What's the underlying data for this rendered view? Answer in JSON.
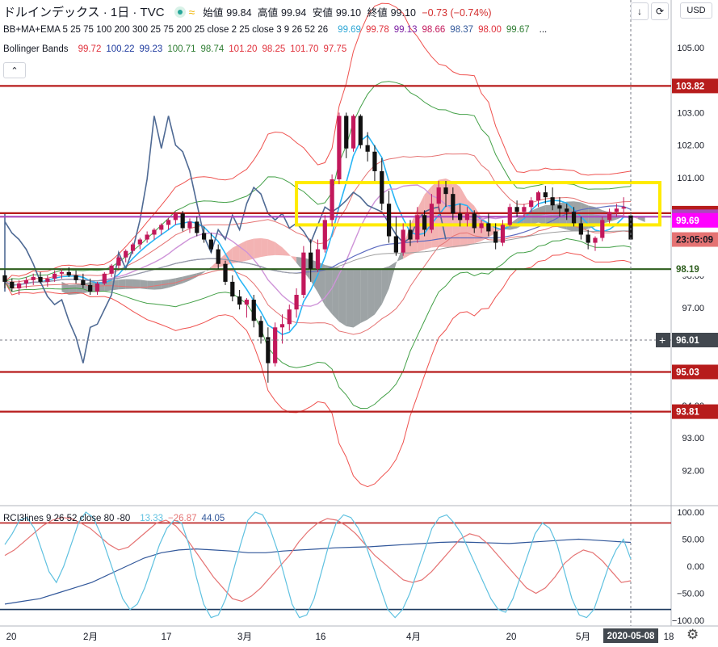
{
  "header": {
    "title": "ドルインデックス · 1日 · TVC",
    "ohlc": [
      {
        "label": "始値",
        "value": "99.84"
      },
      {
        "label": "高値",
        "value": "99.94"
      },
      {
        "label": "安値",
        "value": "99.10"
      },
      {
        "label": "終値",
        "value": "99.10"
      }
    ],
    "change": "−0.73 (−0.74%)",
    "currency": "USD",
    "wave_icon": "≈",
    "down_icon": "↓",
    "refresh_icon": "⟳",
    "collapse_icon": "⌃",
    "gear_icon": "⚙"
  },
  "legend_main": {
    "name": "BB+MA+EMA 5 25 75 100 200 300 25 75 200 25 close 2 25 close 3 9 26 52 26",
    "values": [
      {
        "v": "99.69",
        "color": "#2ea7d6"
      },
      {
        "v": "99.78",
        "color": "#e0303b"
      },
      {
        "v": "99.13",
        "color": "#7b1fa2"
      },
      {
        "v": "98.66",
        "color": "#c2185b"
      },
      {
        "v": "98.37",
        "color": "#31579a"
      },
      {
        "v": "98.00",
        "color": "#e0303b"
      },
      {
        "v": "99.67",
        "color": "#2e7d32"
      }
    ],
    "ellipsis": "..."
  },
  "legend_bb": {
    "name": "Bollinger Bands",
    "values": [
      {
        "v": "99.72",
        "color": "#e0303b"
      },
      {
        "v": "100.22",
        "color": "#1e3a9e"
      },
      {
        "v": "99.23",
        "color": "#1e3a9e"
      },
      {
        "v": "100.71",
        "color": "#2e7d32"
      },
      {
        "v": "98.74",
        "color": "#2e7d32"
      },
      {
        "v": "101.20",
        "color": "#e0303b"
      },
      {
        "v": "98.25",
        "color": "#e0303b"
      },
      {
        "v": "101.70",
        "color": "#e0303b"
      },
      {
        "v": "97.75",
        "color": "#e0303b"
      }
    ]
  },
  "legend_rci": {
    "name": "RCI3lines 9 26 52 close 80 -80",
    "values": [
      {
        "v": "13.33",
        "color": "#5fc1e0"
      },
      {
        "v": "−26.87",
        "color": "#e57373"
      },
      {
        "v": "44.05",
        "color": "#31579a"
      }
    ]
  },
  "chart_data": {
    "type": "candlestick",
    "symbol": "ドルインデックス",
    "y_axis": {
      "ticks": [
        92.0,
        93.0,
        94.0,
        95.0,
        97.0,
        98.0,
        99.0,
        101.0,
        102.0,
        103.0,
        105.0
      ],
      "ylim": [
        91.1,
        106.0
      ]
    },
    "x_axis": {
      "labels": [
        "20",
        "2月",
        "17",
        "3月",
        "16",
        "4月",
        "20",
        "5月",
        "18"
      ]
    },
    "candles": [
      [
        98.0,
        98.15,
        97.6,
        97.8
      ],
      [
        97.8,
        97.9,
        97.5,
        97.6
      ],
      [
        97.6,
        97.85,
        97.4,
        97.75
      ],
      [
        97.75,
        97.95,
        97.6,
        97.85
      ],
      [
        97.85,
        98.05,
        97.7,
        97.95
      ],
      [
        97.95,
        98.1,
        97.75,
        97.8
      ],
      [
        97.8,
        98.0,
        97.65,
        97.9
      ],
      [
        97.9,
        98.15,
        97.8,
        98.05
      ],
      [
        98.05,
        98.2,
        97.9,
        98.1
      ],
      [
        98.1,
        98.25,
        97.95,
        98.0
      ],
      [
        98.0,
        98.15,
        97.75,
        97.85
      ],
      [
        97.85,
        98.05,
        97.6,
        97.7
      ],
      [
        97.7,
        97.9,
        97.4,
        97.5
      ],
      [
        97.5,
        97.8,
        97.4,
        97.75
      ],
      [
        97.75,
        98.1,
        97.7,
        98.05
      ],
      [
        98.05,
        98.35,
        97.95,
        98.3
      ],
      [
        98.3,
        98.6,
        98.2,
        98.55
      ],
      [
        98.55,
        98.8,
        98.4,
        98.75
      ],
      [
        98.75,
        99.0,
        98.65,
        98.95
      ],
      [
        98.95,
        99.15,
        98.8,
        99.1
      ],
      [
        99.1,
        99.35,
        99.0,
        99.25
      ],
      [
        99.25,
        99.45,
        99.1,
        99.4
      ],
      [
        99.4,
        99.6,
        99.25,
        99.55
      ],
      [
        99.55,
        99.75,
        99.4,
        99.7
      ],
      [
        99.7,
        99.95,
        99.55,
        99.9
      ],
      [
        99.9,
        99.98,
        99.35,
        99.45
      ],
      [
        99.45,
        99.75,
        99.3,
        99.65
      ],
      [
        99.65,
        99.8,
        99.2,
        99.3
      ],
      [
        99.3,
        99.5,
        99.0,
        99.1
      ],
      [
        99.1,
        99.3,
        98.7,
        98.8
      ],
      [
        98.8,
        98.95,
        98.2,
        98.35
      ],
      [
        98.35,
        98.45,
        97.7,
        97.8
      ],
      [
        97.8,
        98.0,
        97.2,
        97.35
      ],
      [
        97.35,
        97.55,
        96.95,
        97.1
      ],
      [
        97.1,
        97.3,
        96.7,
        97.25
      ],
      [
        97.25,
        97.4,
        96.4,
        96.6
      ],
      [
        96.6,
        96.75,
        95.9,
        96.1
      ],
      [
        96.1,
        96.4,
        94.7,
        95.3
      ],
      [
        95.3,
        96.55,
        95.2,
        96.4
      ],
      [
        96.4,
        96.8,
        95.9,
        96.5
      ],
      [
        96.5,
        97.1,
        96.3,
        96.95
      ],
      [
        96.95,
        97.6,
        96.7,
        97.4
      ],
      [
        97.4,
        98.9,
        97.3,
        98.7
      ],
      [
        98.7,
        99.1,
        97.8,
        98.2
      ],
      [
        98.2,
        99.1,
        98.1,
        98.8
      ],
      [
        98.8,
        99.85,
        98.7,
        99.7
      ],
      [
        99.7,
        101.1,
        99.5,
        100.95
      ],
      [
        100.95,
        103.0,
        100.8,
        102.9
      ],
      [
        102.9,
        103.0,
        101.6,
        101.9
      ],
      [
        101.9,
        102.95,
        101.8,
        102.9
      ],
      [
        102.9,
        102.95,
        101.9,
        102.0
      ],
      [
        102.0,
        102.4,
        101.5,
        101.8
      ],
      [
        101.8,
        102.0,
        100.9,
        101.2
      ],
      [
        101.2,
        101.6,
        100.0,
        100.2
      ],
      [
        100.2,
        100.6,
        99.0,
        99.2
      ],
      [
        99.2,
        99.8,
        98.6,
        98.7
      ],
      [
        98.7,
        99.6,
        98.6,
        99.4
      ],
      [
        99.4,
        99.7,
        98.9,
        99.1
      ],
      [
        99.1,
        100.1,
        99.0,
        99.85
      ],
      [
        99.85,
        100.0,
        99.2,
        99.4
      ],
      [
        99.4,
        100.5,
        99.3,
        100.2
      ],
      [
        100.2,
        100.9,
        100.0,
        100.7
      ],
      [
        100.7,
        100.9,
        100.1,
        100.5
      ],
      [
        100.5,
        100.7,
        99.7,
        99.9
      ],
      [
        99.9,
        100.2,
        99.5,
        99.7
      ],
      [
        99.7,
        100.1,
        99.5,
        99.9
      ],
      [
        99.9,
        100.0,
        99.3,
        99.45
      ],
      [
        99.45,
        99.7,
        99.3,
        99.6
      ],
      [
        99.6,
        99.9,
        99.2,
        99.35
      ],
      [
        99.35,
        99.6,
        98.8,
        99.0
      ],
      [
        99.0,
        99.7,
        98.9,
        99.55
      ],
      [
        99.55,
        100.2,
        99.5,
        100.1
      ],
      [
        100.1,
        100.3,
        99.8,
        99.95
      ],
      [
        99.95,
        100.2,
        99.8,
        100.1
      ],
      [
        100.1,
        100.4,
        99.9,
        100.3
      ],
      [
        100.3,
        100.6,
        100.1,
        100.55
      ],
      [
        100.55,
        100.75,
        100.2,
        100.4
      ],
      [
        100.4,
        100.7,
        100.0,
        100.15
      ],
      [
        100.15,
        100.4,
        99.8,
        100.05
      ],
      [
        100.05,
        100.2,
        99.7,
        99.95
      ],
      [
        99.95,
        100.1,
        99.5,
        99.6
      ],
      [
        99.6,
        99.8,
        99.1,
        99.25
      ],
      [
        99.25,
        99.4,
        98.8,
        99.0
      ],
      [
        99.0,
        99.2,
        98.75,
        99.15
      ],
      [
        99.15,
        99.8,
        99.05,
        99.7
      ],
      [
        99.7,
        100.05,
        99.6,
        99.95
      ],
      [
        99.95,
        100.2,
        99.8,
        100.05
      ],
      [
        100.05,
        100.4,
        99.85,
        100.1
      ],
      [
        99.84,
        99.94,
        99.1,
        99.1
      ]
    ],
    "horizontal_levels": [
      {
        "value": 103.82,
        "label": "103.82",
        "color": "#b71c1c"
      },
      {
        "value": 99.91,
        "label": "99.91",
        "color": "#b71c1c"
      },
      {
        "value": 99.8,
        "label": "99.80",
        "color": "#ab47bc"
      },
      {
        "value": 98.19,
        "label": "98.19",
        "color": "#2e5e1e"
      },
      {
        "value": 95.03,
        "label": "95.03",
        "color": "#b71c1c"
      },
      {
        "value": 93.81,
        "label": "93.81",
        "color": "#b71c1c"
      }
    ],
    "price_tags": [
      {
        "value": 99.1,
        "label": "23:05:09",
        "color": "#e57373"
      },
      {
        "value": 99.69,
        "label": "99.69",
        "color": "#ff00ff"
      },
      {
        "value": 96.01,
        "label": "96.01",
        "color": "#42484f",
        "cross": "+"
      }
    ],
    "rectangle": {
      "y_top": 100.85,
      "y_bottom": 99.55,
      "color": "#ffeb00"
    },
    "date_tag": "2020-05-08",
    "rci": {
      "ticks": [
        "100.00",
        "50.00",
        "0.00",
        "−50.00",
        "−100.00"
      ],
      "tick_values": [
        100,
        50,
        0,
        -50,
        -100
      ],
      "levels": [
        80,
        -80
      ],
      "fast": [
        40,
        60,
        85,
        90,
        70,
        30,
        -10,
        -30,
        0,
        40,
        80,
        100,
        90,
        60,
        20,
        -20,
        -60,
        -80,
        -70,
        -40,
        0,
        40,
        70,
        85,
        80,
        40,
        -20,
        -70,
        -95,
        -90,
        -60,
        -10,
        40,
        85,
        100,
        95,
        70,
        30,
        -20,
        -70,
        -95,
        -90,
        -60,
        -10,
        40,
        80,
        95,
        90,
        70,
        40,
        0,
        -40,
        -80,
        -95,
        -80,
        -50,
        -10,
        30,
        70,
        90,
        95,
        80,
        60,
        30,
        0,
        -30,
        -60,
        -80,
        -85,
        -60,
        -20,
        20,
        60,
        80,
        70,
        40,
        -10,
        -60,
        -90,
        -95,
        -80,
        -40,
        0,
        30,
        50,
        13.33
      ],
      "mid": [
        20,
        30,
        45,
        60,
        75,
        85,
        90,
        88,
        80,
        70,
        55,
        40,
        30,
        35,
        50,
        65,
        80,
        85,
        75,
        55,
        30,
        5,
        -20,
        -40,
        -60,
        -65,
        -55,
        -40,
        -20,
        0,
        20,
        45,
        65,
        80,
        88,
        85,
        75,
        60,
        40,
        20,
        5,
        -10,
        -25,
        -30,
        -25,
        -10,
        10,
        30,
        50,
        60,
        55,
        40,
        20,
        0,
        -20,
        -40,
        -50,
        -40,
        -20,
        5,
        20,
        30,
        25,
        10,
        -10,
        -30,
        -26.87
      ],
      "slow": [
        -70,
        -65,
        -60,
        -50,
        -40,
        -30,
        -15,
        0,
        15,
        25,
        30,
        32,
        30,
        28,
        25,
        25,
        28,
        30,
        32,
        34,
        35,
        36,
        38,
        40,
        42,
        44,
        45,
        44,
        43,
        42,
        44,
        46,
        48,
        50,
        48,
        46,
        44.05
      ]
    }
  }
}
